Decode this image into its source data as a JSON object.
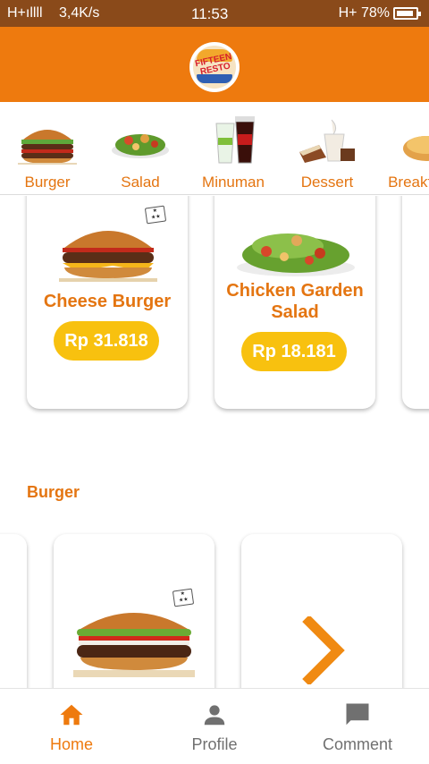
{
  "status_bar": {
    "signal": "H+ıllll",
    "speed": "3,4K/s",
    "time": "11:53",
    "right": "H+ 78%"
  },
  "header": {
    "logo_text": "FIFTEEN RESTO"
  },
  "categories": [
    {
      "label": "Burger"
    },
    {
      "label": "Salad"
    },
    {
      "label": "Minuman"
    },
    {
      "label": "Dessert"
    },
    {
      "label": "Breakfast"
    }
  ],
  "featured": [
    {
      "name": "Cheese Burger",
      "price": "Rp 31.818"
    },
    {
      "name": "Chicken Garden Salad",
      "price": "Rp 18.181"
    }
  ],
  "section": {
    "title": "Burger"
  },
  "bottom_nav": [
    {
      "label": "Home"
    },
    {
      "label": "Profile"
    },
    {
      "label": "Comment"
    }
  ],
  "colors": {
    "accent": "#ee7a0e",
    "status_bar": "#8a4a1a",
    "price_pill": "#f8c10f",
    "text_orange": "#e47511",
    "nav_inactive": "#707070"
  },
  "icons": {
    "home": "home-icon",
    "profile": "person-icon",
    "comment": "chat-bubble-icon",
    "more": "chevron-right-icon"
  }
}
